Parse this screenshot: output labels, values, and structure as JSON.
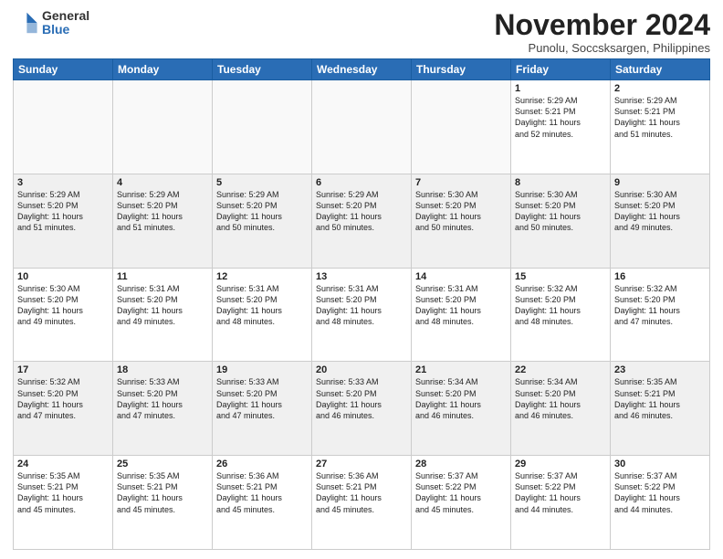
{
  "logo": {
    "general": "General",
    "blue": "Blue"
  },
  "header": {
    "month": "November 2024",
    "location": "Punolu, Soccsksargen, Philippines"
  },
  "days_of_week": [
    "Sunday",
    "Monday",
    "Tuesday",
    "Wednesday",
    "Thursday",
    "Friday",
    "Saturday"
  ],
  "weeks": [
    [
      {
        "day": "",
        "info": "",
        "empty": true
      },
      {
        "day": "",
        "info": "",
        "empty": true
      },
      {
        "day": "",
        "info": "",
        "empty": true
      },
      {
        "day": "",
        "info": "",
        "empty": true
      },
      {
        "day": "",
        "info": "",
        "empty": true
      },
      {
        "day": "1",
        "info": "Sunrise: 5:29 AM\nSunset: 5:21 PM\nDaylight: 11 hours\nand 52 minutes."
      },
      {
        "day": "2",
        "info": "Sunrise: 5:29 AM\nSunset: 5:21 PM\nDaylight: 11 hours\nand 51 minutes."
      }
    ],
    [
      {
        "day": "3",
        "info": "Sunrise: 5:29 AM\nSunset: 5:20 PM\nDaylight: 11 hours\nand 51 minutes."
      },
      {
        "day": "4",
        "info": "Sunrise: 5:29 AM\nSunset: 5:20 PM\nDaylight: 11 hours\nand 51 minutes."
      },
      {
        "day": "5",
        "info": "Sunrise: 5:29 AM\nSunset: 5:20 PM\nDaylight: 11 hours\nand 50 minutes."
      },
      {
        "day": "6",
        "info": "Sunrise: 5:29 AM\nSunset: 5:20 PM\nDaylight: 11 hours\nand 50 minutes."
      },
      {
        "day": "7",
        "info": "Sunrise: 5:30 AM\nSunset: 5:20 PM\nDaylight: 11 hours\nand 50 minutes."
      },
      {
        "day": "8",
        "info": "Sunrise: 5:30 AM\nSunset: 5:20 PM\nDaylight: 11 hours\nand 50 minutes."
      },
      {
        "day": "9",
        "info": "Sunrise: 5:30 AM\nSunset: 5:20 PM\nDaylight: 11 hours\nand 49 minutes."
      }
    ],
    [
      {
        "day": "10",
        "info": "Sunrise: 5:30 AM\nSunset: 5:20 PM\nDaylight: 11 hours\nand 49 minutes."
      },
      {
        "day": "11",
        "info": "Sunrise: 5:31 AM\nSunset: 5:20 PM\nDaylight: 11 hours\nand 49 minutes."
      },
      {
        "day": "12",
        "info": "Sunrise: 5:31 AM\nSunset: 5:20 PM\nDaylight: 11 hours\nand 48 minutes."
      },
      {
        "day": "13",
        "info": "Sunrise: 5:31 AM\nSunset: 5:20 PM\nDaylight: 11 hours\nand 48 minutes."
      },
      {
        "day": "14",
        "info": "Sunrise: 5:31 AM\nSunset: 5:20 PM\nDaylight: 11 hours\nand 48 minutes."
      },
      {
        "day": "15",
        "info": "Sunrise: 5:32 AM\nSunset: 5:20 PM\nDaylight: 11 hours\nand 48 minutes."
      },
      {
        "day": "16",
        "info": "Sunrise: 5:32 AM\nSunset: 5:20 PM\nDaylight: 11 hours\nand 47 minutes."
      }
    ],
    [
      {
        "day": "17",
        "info": "Sunrise: 5:32 AM\nSunset: 5:20 PM\nDaylight: 11 hours\nand 47 minutes."
      },
      {
        "day": "18",
        "info": "Sunrise: 5:33 AM\nSunset: 5:20 PM\nDaylight: 11 hours\nand 47 minutes."
      },
      {
        "day": "19",
        "info": "Sunrise: 5:33 AM\nSunset: 5:20 PM\nDaylight: 11 hours\nand 47 minutes."
      },
      {
        "day": "20",
        "info": "Sunrise: 5:33 AM\nSunset: 5:20 PM\nDaylight: 11 hours\nand 46 minutes."
      },
      {
        "day": "21",
        "info": "Sunrise: 5:34 AM\nSunset: 5:20 PM\nDaylight: 11 hours\nand 46 minutes."
      },
      {
        "day": "22",
        "info": "Sunrise: 5:34 AM\nSunset: 5:20 PM\nDaylight: 11 hours\nand 46 minutes."
      },
      {
        "day": "23",
        "info": "Sunrise: 5:35 AM\nSunset: 5:21 PM\nDaylight: 11 hours\nand 46 minutes."
      }
    ],
    [
      {
        "day": "24",
        "info": "Sunrise: 5:35 AM\nSunset: 5:21 PM\nDaylight: 11 hours\nand 45 minutes."
      },
      {
        "day": "25",
        "info": "Sunrise: 5:35 AM\nSunset: 5:21 PM\nDaylight: 11 hours\nand 45 minutes."
      },
      {
        "day": "26",
        "info": "Sunrise: 5:36 AM\nSunset: 5:21 PM\nDaylight: 11 hours\nand 45 minutes."
      },
      {
        "day": "27",
        "info": "Sunrise: 5:36 AM\nSunset: 5:21 PM\nDaylight: 11 hours\nand 45 minutes."
      },
      {
        "day": "28",
        "info": "Sunrise: 5:37 AM\nSunset: 5:22 PM\nDaylight: 11 hours\nand 45 minutes."
      },
      {
        "day": "29",
        "info": "Sunrise: 5:37 AM\nSunset: 5:22 PM\nDaylight: 11 hours\nand 44 minutes."
      },
      {
        "day": "30",
        "info": "Sunrise: 5:37 AM\nSunset: 5:22 PM\nDaylight: 11 hours\nand 44 minutes."
      }
    ]
  ]
}
